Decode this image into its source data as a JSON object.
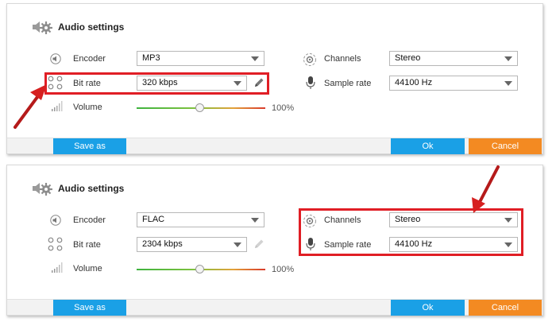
{
  "panels": [
    {
      "title": "Audio settings",
      "encoder": {
        "label": "Encoder",
        "value": "MP3"
      },
      "bitrate": {
        "label": "Bit rate",
        "value": "320 kbps"
      },
      "volume": {
        "label": "Volume",
        "percent": "100%",
        "level": 0.5
      },
      "channels": {
        "label": "Channels",
        "value": "Stereo"
      },
      "sample_rate": {
        "label": "Sample rate",
        "value": "44100 Hz"
      },
      "buttons": {
        "save_as": "Save as",
        "ok": "Ok",
        "cancel": "Cancel"
      }
    },
    {
      "title": "Audio settings",
      "encoder": {
        "label": "Encoder",
        "value": "FLAC"
      },
      "bitrate": {
        "label": "Bit rate",
        "value": "2304 kbps"
      },
      "volume": {
        "label": "Volume",
        "percent": "100%",
        "level": 0.5
      },
      "channels": {
        "label": "Channels",
        "value": "Stereo"
      },
      "sample_rate": {
        "label": "Sample rate",
        "value": "44100 Hz"
      },
      "buttons": {
        "save_as": "Save as",
        "ok": "Ok",
        "cancel": "Cancel"
      }
    }
  ],
  "colors": {
    "highlight": "#e01e25",
    "button_blue": "#1aa0e6",
    "button_orange": "#f38a22"
  }
}
